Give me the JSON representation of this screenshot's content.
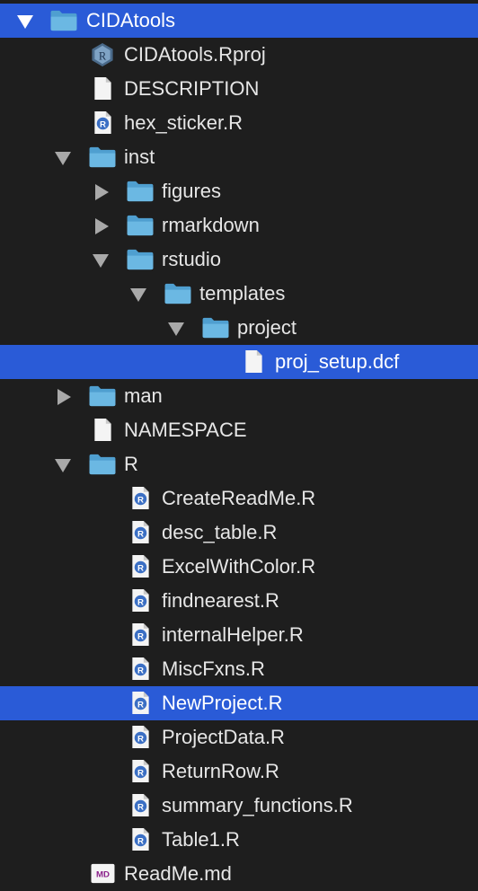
{
  "tree": {
    "root": "CIDAtools",
    "rproj": "CIDAtools.Rproj",
    "description": "DESCRIPTION",
    "hex_sticker": "hex_sticker.R",
    "inst": "inst",
    "figures": "figures",
    "rmarkdown": "rmarkdown",
    "rstudio": "rstudio",
    "templates": "templates",
    "project": "project",
    "proj_setup": "proj_setup.dcf",
    "man": "man",
    "namespace": "NAMESPACE",
    "r_dir": "R",
    "r_files": [
      "CreateReadMe.R",
      "desc_table.R",
      "ExcelWithColor.R",
      "findnearest.R",
      "internalHelper.R",
      "MiscFxns.R",
      "NewProject.R",
      "ProjectData.R",
      "ReturnRow.R",
      "summary_functions.R",
      "Table1.R"
    ],
    "readme": "ReadMe.md"
  },
  "icons": {
    "folder": "folder-icon",
    "doc": "document-icon",
    "rscript": "r-script-icon",
    "rproj": "r-project-icon",
    "markdown": "markdown-icon"
  },
  "colors": {
    "selection": "#2a5bd7",
    "folder": "#5aa9d6",
    "background": "#1e1e1e"
  }
}
